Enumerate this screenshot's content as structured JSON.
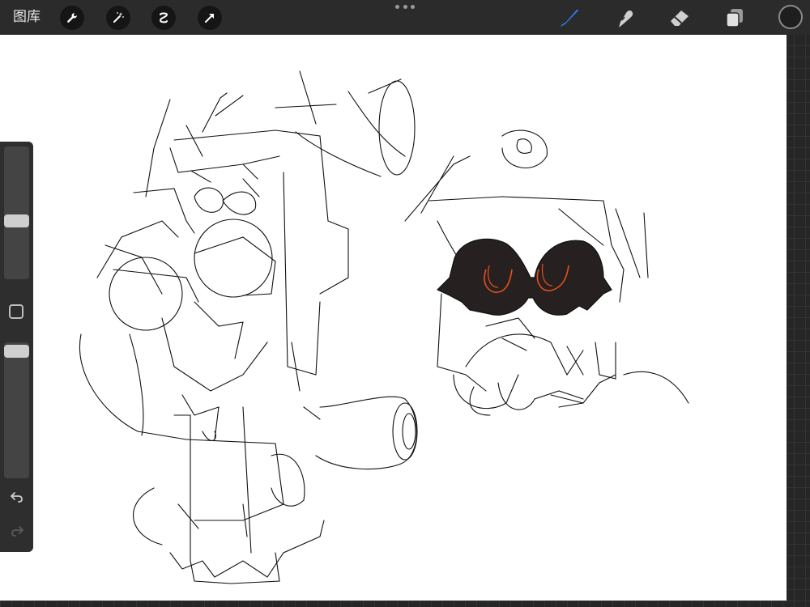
{
  "toolbar": {
    "gallery_label": "图库",
    "left_tools": [
      "wrench-icon",
      "magic-wand-icon",
      "selection-icon",
      "transform-arrow-icon"
    ],
    "right_tools": [
      "brush-icon",
      "smudge-icon",
      "eraser-icon",
      "layers-icon"
    ],
    "active_tool": "brush-icon",
    "accent_color": "#2f7bf0",
    "current_color": "#1e1e1e"
  },
  "sidebar": {
    "brush_size_level": 0.55,
    "opacity_level": 0.02,
    "controls": [
      "modify-button",
      "undo-icon",
      "redo-icon"
    ]
  },
  "canvas": {
    "background": "#ffffff",
    "content": "sketch",
    "ink_color": "#111111",
    "fill_color": "#262020",
    "highlight_color": "#e8501a"
  }
}
